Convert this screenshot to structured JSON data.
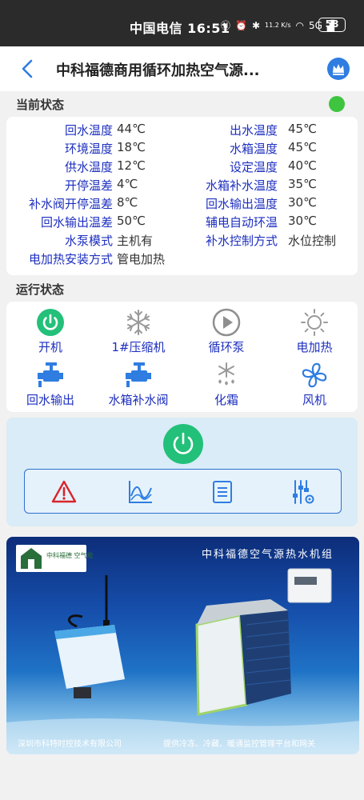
{
  "statusbar": {
    "carrier_time": "中国电信 16:51",
    "net_speed": "11.2 K/s",
    "network": "5G",
    "battery": "58"
  },
  "header": {
    "title": "中科福德商用循环加热空气源..."
  },
  "sections": {
    "current_status": "当前状态",
    "run_status": "运行状态"
  },
  "status_rows": [
    {
      "k1": "回水温度",
      "v1": "44℃",
      "k2": "出水温度",
      "v2": "45℃"
    },
    {
      "k1": "环境温度",
      "v1": "18℃",
      "k2": "水箱温度",
      "v2": "45℃"
    },
    {
      "k1": "供水温度",
      "v1": "12℃",
      "k2": "设定温度",
      "v2": "40℃"
    },
    {
      "k1": "开停温差",
      "v1": "4℃",
      "k2": "水箱补水温度",
      "v2": "35℃"
    },
    {
      "k1": "补水阀开停温差",
      "v1": "8℃",
      "k2": "回水输出温度",
      "v2": "30℃"
    },
    {
      "k1": "回水输出温差",
      "v1": "50℃",
      "k2": "辅电自动环温",
      "v2": "30℃"
    },
    {
      "k1": "水泵模式",
      "v1": "主机有",
      "k2": "补水控制方式",
      "v2": "水位控制"
    },
    {
      "k1": "电加热安装方式",
      "v1": "管电加热",
      "k2": "",
      "v2": ""
    }
  ],
  "run_items": [
    {
      "label": "开机",
      "icon": "power-on-icon",
      "active": true
    },
    {
      "label": "1#压缩机",
      "icon": "snowflake-icon",
      "active": false
    },
    {
      "label": "循环泵",
      "icon": "play-circle-icon",
      "active": false
    },
    {
      "label": "电加热",
      "icon": "sun-icon",
      "active": false
    },
    {
      "label": "回水输出",
      "icon": "valve-icon",
      "active": true
    },
    {
      "label": "水箱补水阀",
      "icon": "valve-icon",
      "active": true
    },
    {
      "label": "化霜",
      "icon": "defrost-icon",
      "active": false
    },
    {
      "label": "风机",
      "icon": "fan-icon",
      "active": true
    }
  ],
  "toolbar": {
    "tools": [
      "alarm-icon",
      "curve-chart-icon",
      "list-icon",
      "settings-sliders-icon"
    ]
  },
  "banner": {
    "logo_text": "中科福德 空气能",
    "title": "中科福德空气源热水机组",
    "footer_left": "深圳市科特时控技术有限公司",
    "footer_right": "提供冷冻、冷藏、暖通监控管理平台和网关"
  },
  "colors": {
    "accent_blue": "#2f7de1",
    "label_blue": "#1d2fbf",
    "active_green": "#23c07a",
    "online_green": "#3ec43e"
  }
}
